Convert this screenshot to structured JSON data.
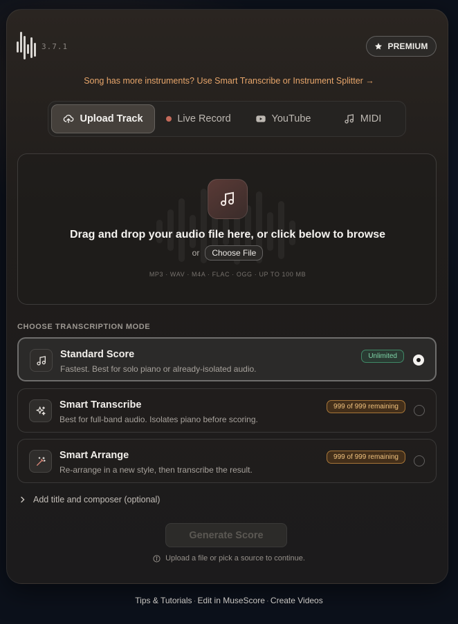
{
  "header": {
    "version": "3.7.1",
    "premium_label": "PREMIUM",
    "promo_text": "Song has more instruments? Use Smart Transcribe or Instrument Splitter →"
  },
  "tabs": [
    {
      "label": "Upload Track",
      "icon": "upload-cloud-icon",
      "active": true
    },
    {
      "label": "Live Record",
      "icon": "record-dot-icon",
      "active": false
    },
    {
      "label": "YouTube",
      "icon": "youtube-icon",
      "active": false
    },
    {
      "label": "MIDI",
      "icon": "music-note-icon",
      "active": false
    }
  ],
  "dropzone": {
    "title": "Drag and drop your audio file here, or click below to browse",
    "or_text": "or",
    "choose_label": "Choose File",
    "formats": "MP3 · WAV · M4A · FLAC · OGG · UP TO 100 MB"
  },
  "modes": {
    "heading": "CHOOSE TRANSCRIPTION MODE",
    "items": [
      {
        "title": "Standard Score",
        "desc": "Fastest. Best for solo piano or already-isolated audio.",
        "badge": "Unlimited",
        "badge_color": "#7fd5a8",
        "selected": true,
        "icon": "music-note-icon"
      },
      {
        "title": "Smart Transcribe",
        "desc": "Best for full-band audio. Isolates piano before scoring.",
        "badge": "999 of 999 remaining",
        "badge_color": "#f0c27e",
        "selected": false,
        "icon": "sparkles-icon"
      },
      {
        "title": "Smart Arrange",
        "desc": "Re-arrange in a new style, then transcribe the result.",
        "badge": "999 of 999 remaining",
        "badge_color": "#f0c27e",
        "selected": false,
        "icon": "magic-wand-icon"
      }
    ]
  },
  "add_title_label": "Add title and composer (optional)",
  "generate_label": "Generate Score",
  "hint_text": "Upload a file or pick a source to continue.",
  "footer": {
    "links": [
      "Tips & Tutorials",
      "Edit in MuseScore",
      "Create Videos"
    ],
    "separator": "·"
  },
  "colors": {
    "accent_promo": "#e8a66b",
    "unlimited_badge": "#7fd5a8",
    "remaining_badge": "#f0c27e",
    "record_dot": "#c46a5a"
  }
}
